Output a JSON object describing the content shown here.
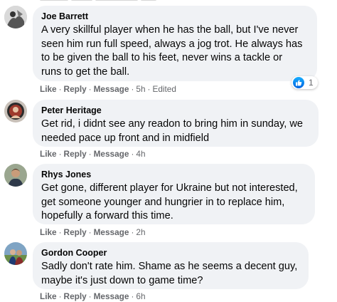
{
  "comments": [
    {
      "author": "Joe Barrett",
      "text": "A very skillful player when he has the ball, but I've never\nseen him run full speed, always a jog trot. He always has\nto be given the ball to his feet, never wins a tackle or\nruns to get the ball.",
      "actions": [
        "Like",
        "Reply",
        "Message"
      ],
      "time": "5h",
      "edited": "Edited",
      "reaction_count": "1"
    },
    {
      "author": "Peter Heritage",
      "text": "Get rid, i didnt see any readon to bring him in sunday, we\nneeded pace up front and in midfield",
      "actions": [
        "Like",
        "Reply",
        "Message"
      ],
      "time": "4h"
    },
    {
      "author": "Rhys Jones",
      "text": "Get gone, different player for Ukraine but not interested,\nget someone younger and hungrier in to replace him,\nhopefully a forward this time.",
      "actions": [
        "Like",
        "Reply",
        "Message"
      ],
      "time": "2h"
    },
    {
      "author": "Gordon Cooper",
      "text": "Sadly don't rate him. Shame as he seems a decent guy,\nmaybe it's just down to game time?",
      "actions": [
        "Like",
        "Reply",
        "Message"
      ],
      "time": "6h"
    }
  ],
  "separator": "·",
  "colors": {
    "bubble": "#f0f2f5",
    "meta": "#65676b",
    "like_blue": "#1877f2"
  }
}
